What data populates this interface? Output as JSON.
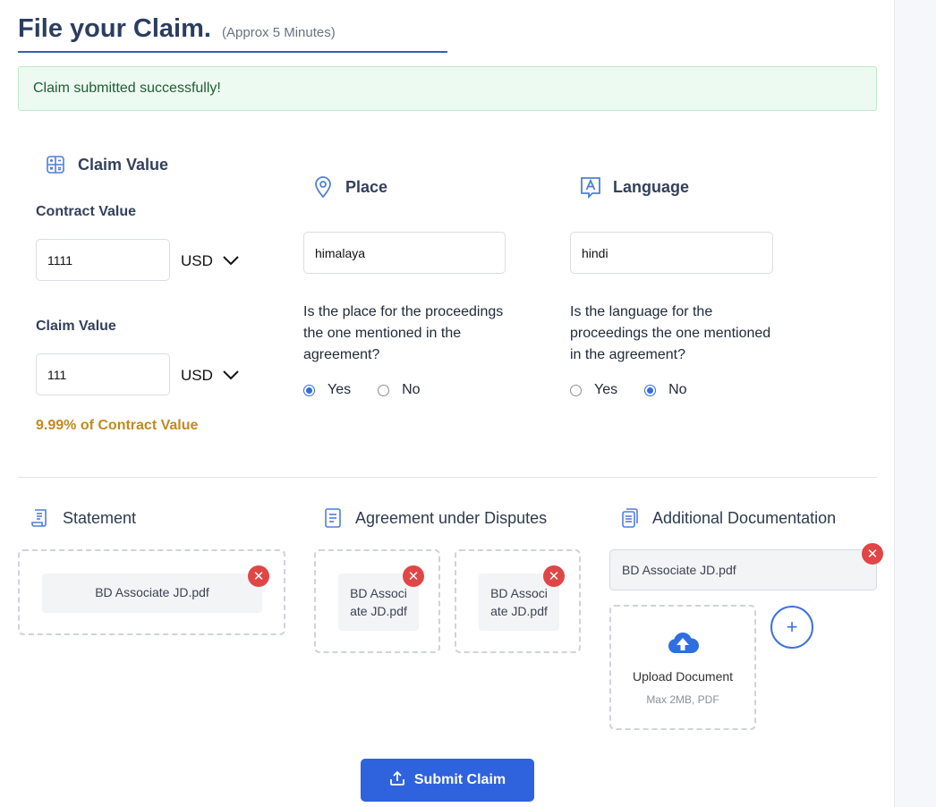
{
  "page": {
    "title": "File your Claim.",
    "subtitle": "(Approx 5 Minutes)"
  },
  "alert": {
    "message": "Claim submitted successfully!"
  },
  "claim_value": {
    "heading": "Claim Value",
    "contract_label": "Contract Value",
    "contract_value": "1111",
    "contract_currency": "USD",
    "claim_label": "Claim Value",
    "claim_value": "111",
    "claim_currency": "USD",
    "percentage_text": "9.99% of Contract Value"
  },
  "place": {
    "heading": "Place",
    "value": "himalaya",
    "question": "Is the place for the proceedings the one mentioned in the agreement?",
    "options": [
      {
        "label": "Yes",
        "selected": true
      },
      {
        "label": "No",
        "selected": false
      }
    ]
  },
  "language": {
    "heading": "Language",
    "value": "hindi",
    "question": "Is the language for the proceedings the one mentioned in the agreement?",
    "options": [
      {
        "label": "Yes",
        "selected": false
      },
      {
        "label": "No",
        "selected": true
      }
    ]
  },
  "documents": {
    "statement": {
      "heading": "Statement",
      "files": [
        "BD Associate JD.pdf"
      ]
    },
    "agreement": {
      "heading": "Agreement under Disputes",
      "files": [
        "BD Associ ate JD.pdf",
        "BD Associ ate JD.pdf"
      ]
    },
    "additional": {
      "heading": "Additional Documentation",
      "files": [
        "BD Associate JD.pdf"
      ],
      "upload_label": "Upload Document",
      "upload_hint": "Max 2MB, PDF",
      "add_label": "+"
    }
  },
  "actions": {
    "submit_label": "Submit Claim"
  },
  "colors": {
    "accent": "#2f62dd",
    "success_bg": "#edfaf1",
    "warning_text": "#c3891f",
    "remove": "#e04646"
  },
  "icons": {
    "claim_value": "calculator-icon",
    "place": "location-pin-icon",
    "language": "language-icon",
    "statement": "scroll-document-icon",
    "agreement": "list-document-icon",
    "additional": "copy-documents-icon",
    "upload": "cloud-upload-icon",
    "submit": "upload-arrow-icon",
    "remove": "close-icon"
  }
}
